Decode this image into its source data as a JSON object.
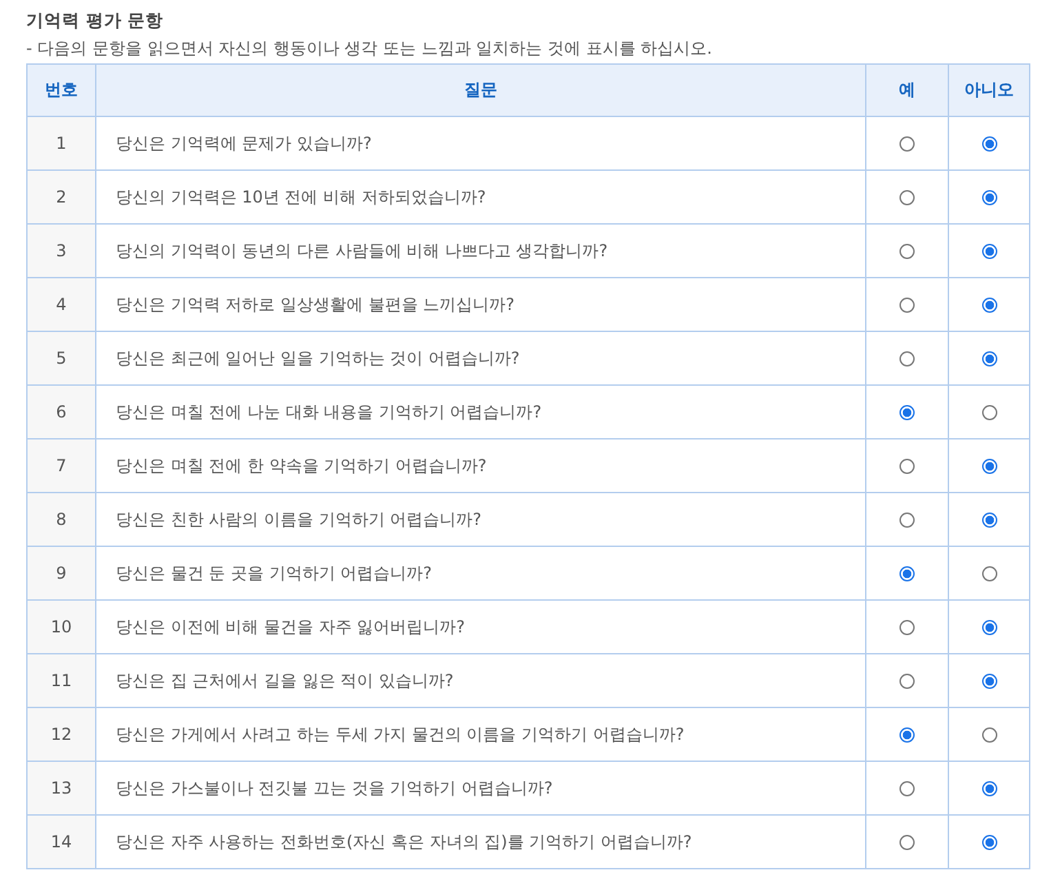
{
  "title": "기억력 평가 문항",
  "instruction": "- 다음의 문항을 읽으면서 자신의 행동이나 생각 또는 느낌과 일치하는 것에 표시를 하십시오.",
  "table": {
    "columns": [
      "번호",
      "질문",
      "예",
      "아니오"
    ],
    "rows": [
      {
        "number": "1",
        "question": "당신은 기억력에 문제가 있습니까?",
        "answers": [
          {
            "selected": false
          },
          {
            "selected": true
          }
        ]
      },
      {
        "number": "2",
        "question": "당신의 기억력은 10년 전에 비해 저하되었습니까?",
        "answers": [
          {
            "selected": false
          },
          {
            "selected": true
          }
        ]
      },
      {
        "number": "3",
        "question": "당신의 기억력이 동년의 다른 사람들에 비해 나쁘다고 생각합니까?",
        "answers": [
          {
            "selected": false
          },
          {
            "selected": true
          }
        ]
      },
      {
        "number": "4",
        "question": "당신은 기억력 저하로 일상생활에 불편을 느끼십니까?",
        "answers": [
          {
            "selected": false
          },
          {
            "selected": true
          }
        ]
      },
      {
        "number": "5",
        "question": "당신은 최근에 일어난 일을 기억하는 것이 어렵습니까?",
        "answers": [
          {
            "selected": false
          },
          {
            "selected": true
          }
        ]
      },
      {
        "number": "6",
        "question": "당신은 며칠 전에 나눈 대화 내용을 기억하기 어렵습니까?",
        "answers": [
          {
            "selected": true
          },
          {
            "selected": false
          }
        ]
      },
      {
        "number": "7",
        "question": "당신은 며칠 전에 한 약속을 기억하기 어렵습니까?",
        "answers": [
          {
            "selected": false
          },
          {
            "selected": true
          }
        ]
      },
      {
        "number": "8",
        "question": "당신은 친한 사람의 이름을 기억하기 어렵습니까?",
        "answers": [
          {
            "selected": false
          },
          {
            "selected": true
          }
        ]
      },
      {
        "number": "9",
        "question": "당신은 물건 둔 곳을 기억하기 어렵습니까?",
        "answers": [
          {
            "selected": true
          },
          {
            "selected": false
          }
        ]
      },
      {
        "number": "10",
        "question": "당신은 이전에 비해 물건을 자주 잃어버립니까?",
        "answers": [
          {
            "selected": false
          },
          {
            "selected": true
          }
        ]
      },
      {
        "number": "11",
        "question": "당신은 집 근처에서 길을 잃은 적이 있습니까?",
        "answers": [
          {
            "selected": false
          },
          {
            "selected": true
          }
        ]
      },
      {
        "number": "12",
        "question": "당신은 가게에서 사려고 하는 두세 가지 물건의 이름을 기억하기 어렵습니까?",
        "answers": [
          {
            "selected": true
          },
          {
            "selected": false
          }
        ]
      },
      {
        "number": "13",
        "question": "당신은 가스불이나 전깃불 끄는 것을 기억하기 어렵습니까?",
        "answers": [
          {
            "selected": false
          },
          {
            "selected": true
          }
        ]
      },
      {
        "number": "14",
        "question": "당신은 자주 사용하는 전화번호(자신 혹은 자녀의 집)를 기억하기 어렵습니까?",
        "answers": [
          {
            "selected": false
          },
          {
            "selected": true
          }
        ]
      }
    ]
  }
}
